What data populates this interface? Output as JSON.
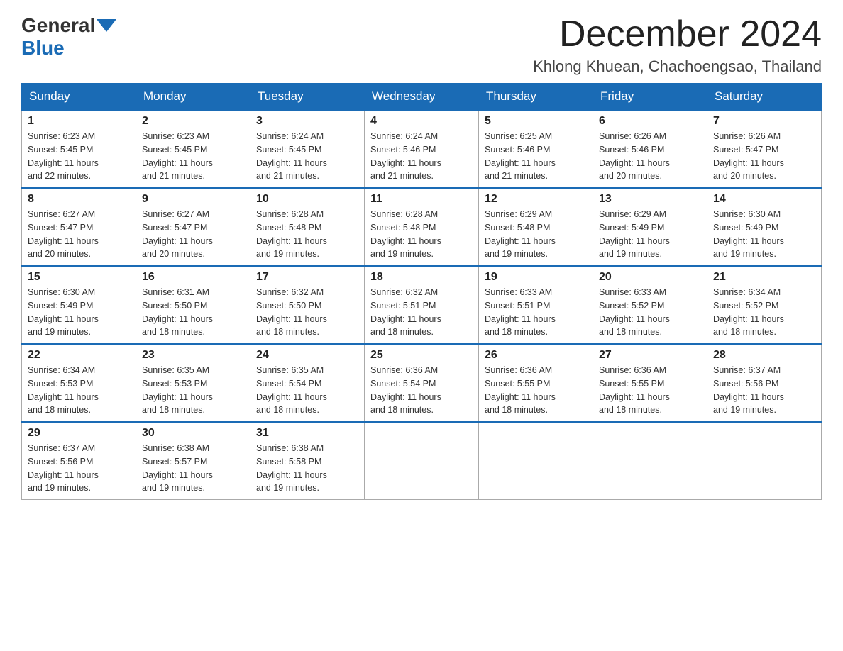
{
  "header": {
    "logo_general": "General",
    "logo_blue": "Blue",
    "month_title": "December 2024",
    "location": "Khlong Khuean, Chachoengsao, Thailand"
  },
  "weekdays": [
    "Sunday",
    "Monday",
    "Tuesday",
    "Wednesday",
    "Thursday",
    "Friday",
    "Saturday"
  ],
  "weeks": [
    [
      {
        "day": "1",
        "sunrise": "6:23 AM",
        "sunset": "5:45 PM",
        "daylight": "11 hours and 22 minutes."
      },
      {
        "day": "2",
        "sunrise": "6:23 AM",
        "sunset": "5:45 PM",
        "daylight": "11 hours and 21 minutes."
      },
      {
        "day": "3",
        "sunrise": "6:24 AM",
        "sunset": "5:45 PM",
        "daylight": "11 hours and 21 minutes."
      },
      {
        "day": "4",
        "sunrise": "6:24 AM",
        "sunset": "5:46 PM",
        "daylight": "11 hours and 21 minutes."
      },
      {
        "day": "5",
        "sunrise": "6:25 AM",
        "sunset": "5:46 PM",
        "daylight": "11 hours and 21 minutes."
      },
      {
        "day": "6",
        "sunrise": "6:26 AM",
        "sunset": "5:46 PM",
        "daylight": "11 hours and 20 minutes."
      },
      {
        "day": "7",
        "sunrise": "6:26 AM",
        "sunset": "5:47 PM",
        "daylight": "11 hours and 20 minutes."
      }
    ],
    [
      {
        "day": "8",
        "sunrise": "6:27 AM",
        "sunset": "5:47 PM",
        "daylight": "11 hours and 20 minutes."
      },
      {
        "day": "9",
        "sunrise": "6:27 AM",
        "sunset": "5:47 PM",
        "daylight": "11 hours and 20 minutes."
      },
      {
        "day": "10",
        "sunrise": "6:28 AM",
        "sunset": "5:48 PM",
        "daylight": "11 hours and 19 minutes."
      },
      {
        "day": "11",
        "sunrise": "6:28 AM",
        "sunset": "5:48 PM",
        "daylight": "11 hours and 19 minutes."
      },
      {
        "day": "12",
        "sunrise": "6:29 AM",
        "sunset": "5:48 PM",
        "daylight": "11 hours and 19 minutes."
      },
      {
        "day": "13",
        "sunrise": "6:29 AM",
        "sunset": "5:49 PM",
        "daylight": "11 hours and 19 minutes."
      },
      {
        "day": "14",
        "sunrise": "6:30 AM",
        "sunset": "5:49 PM",
        "daylight": "11 hours and 19 minutes."
      }
    ],
    [
      {
        "day": "15",
        "sunrise": "6:30 AM",
        "sunset": "5:49 PM",
        "daylight": "11 hours and 19 minutes."
      },
      {
        "day": "16",
        "sunrise": "6:31 AM",
        "sunset": "5:50 PM",
        "daylight": "11 hours and 18 minutes."
      },
      {
        "day": "17",
        "sunrise": "6:32 AM",
        "sunset": "5:50 PM",
        "daylight": "11 hours and 18 minutes."
      },
      {
        "day": "18",
        "sunrise": "6:32 AM",
        "sunset": "5:51 PM",
        "daylight": "11 hours and 18 minutes."
      },
      {
        "day": "19",
        "sunrise": "6:33 AM",
        "sunset": "5:51 PM",
        "daylight": "11 hours and 18 minutes."
      },
      {
        "day": "20",
        "sunrise": "6:33 AM",
        "sunset": "5:52 PM",
        "daylight": "11 hours and 18 minutes."
      },
      {
        "day": "21",
        "sunrise": "6:34 AM",
        "sunset": "5:52 PM",
        "daylight": "11 hours and 18 minutes."
      }
    ],
    [
      {
        "day": "22",
        "sunrise": "6:34 AM",
        "sunset": "5:53 PM",
        "daylight": "11 hours and 18 minutes."
      },
      {
        "day": "23",
        "sunrise": "6:35 AM",
        "sunset": "5:53 PM",
        "daylight": "11 hours and 18 minutes."
      },
      {
        "day": "24",
        "sunrise": "6:35 AM",
        "sunset": "5:54 PM",
        "daylight": "11 hours and 18 minutes."
      },
      {
        "day": "25",
        "sunrise": "6:36 AM",
        "sunset": "5:54 PM",
        "daylight": "11 hours and 18 minutes."
      },
      {
        "day": "26",
        "sunrise": "6:36 AM",
        "sunset": "5:55 PM",
        "daylight": "11 hours and 18 minutes."
      },
      {
        "day": "27",
        "sunrise": "6:36 AM",
        "sunset": "5:55 PM",
        "daylight": "11 hours and 18 minutes."
      },
      {
        "day": "28",
        "sunrise": "6:37 AM",
        "sunset": "5:56 PM",
        "daylight": "11 hours and 19 minutes."
      }
    ],
    [
      {
        "day": "29",
        "sunrise": "6:37 AM",
        "sunset": "5:56 PM",
        "daylight": "11 hours and 19 minutes."
      },
      {
        "day": "30",
        "sunrise": "6:38 AM",
        "sunset": "5:57 PM",
        "daylight": "11 hours and 19 minutes."
      },
      {
        "day": "31",
        "sunrise": "6:38 AM",
        "sunset": "5:58 PM",
        "daylight": "11 hours and 19 minutes."
      },
      null,
      null,
      null,
      null
    ]
  ],
  "labels": {
    "sunrise": "Sunrise:",
    "sunset": "Sunset:",
    "daylight": "Daylight:"
  }
}
